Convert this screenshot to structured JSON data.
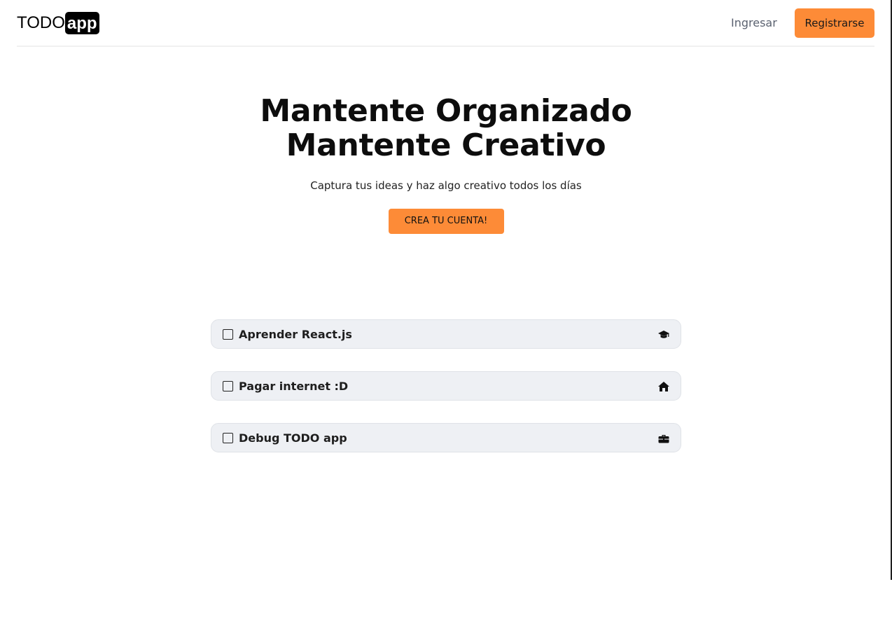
{
  "brand": {
    "todo": "TODO",
    "app": "app"
  },
  "nav": {
    "login": "Ingresar",
    "register": "Registrarse"
  },
  "hero": {
    "title_line1": "Mantente Organizado",
    "title_line2": "Mantente Creativo",
    "subtitle": "Captura tus ideas y haz algo creativo todos los días",
    "cta": "CREA TU CUENTA!"
  },
  "todos": [
    {
      "label": "Aprender React.js",
      "icon": "graduation-cap-icon",
      "checked": false
    },
    {
      "label": "Pagar internet :D",
      "icon": "home-icon",
      "checked": false
    },
    {
      "label": "Debug TODO app",
      "icon": "briefcase-icon",
      "checked": false
    }
  ],
  "colors": {
    "accent": "#fd8b37",
    "item_bg": "#eef0f4",
    "text": "#111827"
  }
}
